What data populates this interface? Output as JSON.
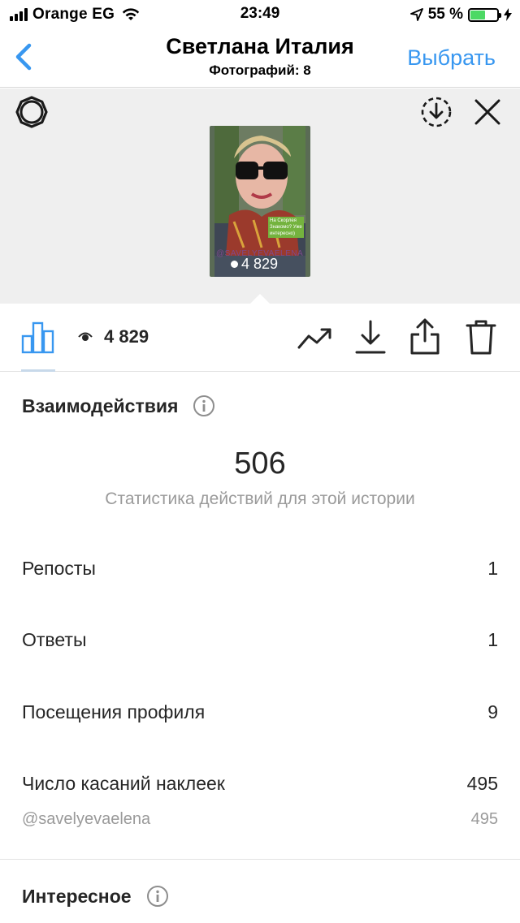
{
  "status_bar": {
    "carrier": "Orange EG",
    "time": "23:49",
    "battery_percent": "55 %",
    "battery_level": 0.55,
    "battery_color": "#4cd964"
  },
  "nav": {
    "title": "Светлана Италия",
    "subtitle": "Фотографий: 8",
    "select_label": "Выбрать",
    "accent_color": "#3897f0",
    "back_icon": "chevron-left-icon"
  },
  "story": {
    "username_tag": "@SAVELYEVAELENA",
    "sticker_text": "На Скорлея Знакомо? Уже интересно)",
    "view_count": "4 829",
    "icons": [
      "settings-icon",
      "download-circle-icon",
      "close-icon"
    ]
  },
  "actions": {
    "views": "4 829",
    "icons": [
      "bar-chart-icon",
      "eye-icon",
      "trend-icon",
      "download-icon",
      "share-icon",
      "trash-icon"
    ]
  },
  "interactions": {
    "title": "Взаимодействия",
    "total": "506",
    "caption": "Статистика действий для этой истории",
    "rows": [
      {
        "label": "Репосты",
        "value": "1"
      },
      {
        "label": "Ответы",
        "value": "1"
      },
      {
        "label": "Посещения профиля",
        "value": "9"
      },
      {
        "label": "Число касаний наклеек",
        "value": "495"
      }
    ],
    "sub_row": {
      "label": "@savelyevaelena",
      "value": "495"
    }
  },
  "discovery": {
    "title": "Интересное"
  }
}
